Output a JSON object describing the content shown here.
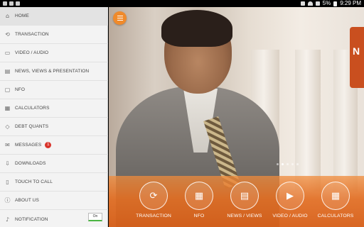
{
  "status_bar": {
    "battery": "5%",
    "time": "9:29 PM"
  },
  "sidebar": {
    "items": [
      {
        "label": "HOME",
        "icon": "home-icon",
        "active": true
      },
      {
        "label": "TRANSACTION",
        "icon": "transaction-icon"
      },
      {
        "label": "VIDEO / AUDIO",
        "icon": "video-icon"
      },
      {
        "label": "NEWS, VIEWS & PRESENTATION",
        "icon": "news-icon"
      },
      {
        "label": "NFO",
        "icon": "nfo-icon"
      },
      {
        "label": "CALCULATORS",
        "icon": "calculator-icon"
      },
      {
        "label": "DEBT QUANTS",
        "icon": "tag-icon"
      },
      {
        "label": "MESSAGES",
        "icon": "mail-icon",
        "badge": "1"
      },
      {
        "label": "DOWNLOADS",
        "icon": "download-icon"
      },
      {
        "label": "TOUCH TO CALL",
        "icon": "phone-icon"
      },
      {
        "label": "ABOUT US",
        "icon": "info-icon"
      },
      {
        "label": "NOTIFICATION",
        "icon": "bell-icon",
        "toggle": "On"
      }
    ]
  },
  "hero": {
    "promo_letter": "N"
  },
  "carousel": {
    "total": 5,
    "active": 2
  },
  "quick_actions": [
    {
      "label": "TRANSACTION",
      "icon": "transaction-icon"
    },
    {
      "label": "NFO",
      "icon": "calendar-icon"
    },
    {
      "label": "NEWS / VIEWS",
      "icon": "news-icon"
    },
    {
      "label": "VIDEO / AUDIO",
      "icon": "video-icon"
    },
    {
      "label": "CALCULATORS",
      "icon": "calculator-icon"
    }
  ],
  "colors": {
    "accent": "#F08A2B",
    "overlay": "#E0722B",
    "badge": "#D9342B",
    "toggle_on": "#4BB543"
  }
}
